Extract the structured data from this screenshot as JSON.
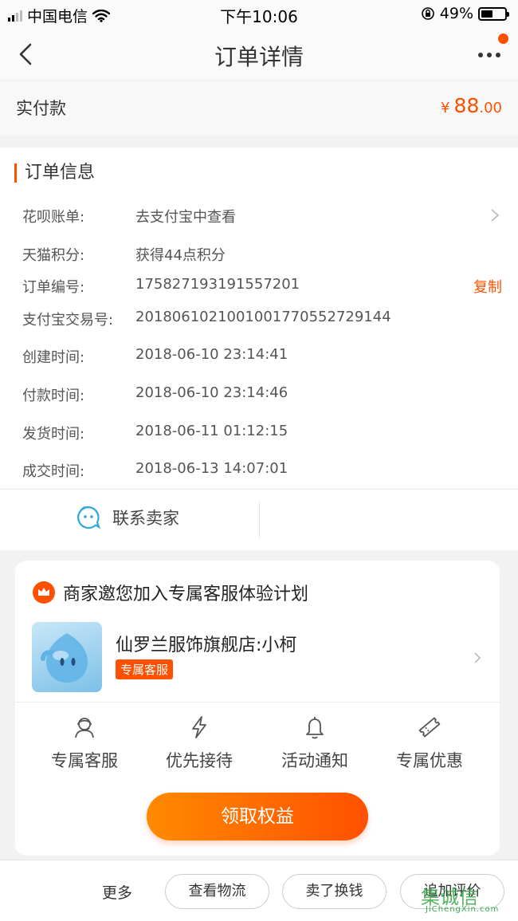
{
  "status_bar": {
    "carrier": "中国电信",
    "time": "下午10:06",
    "battery": "49%",
    "battery_level": 0.49
  },
  "nav": {
    "title": "订单详情"
  },
  "payment": {
    "label": "实付款",
    "currency": "¥",
    "amount_int": "88",
    "amount_dec": ".00"
  },
  "order_info": {
    "title": "订单信息",
    "rows": [
      {
        "key": "花呗账单:",
        "value": "去支付宝中查看"
      },
      {
        "key": "天猫积分:",
        "value": "获得44点积分"
      },
      {
        "key": "订单编号:",
        "value": "175827193191557201",
        "action": "复制"
      },
      {
        "key": "支付宝交易号:",
        "value": "2018061021001001770552729144"
      },
      {
        "key": "创建时间:",
        "value": "2018-06-10 23:14:41"
      },
      {
        "key": "付款时间:",
        "value": "2018-06-10 23:14:46"
      },
      {
        "key": "发货时间:",
        "value": "2018-06-11 01:12:15"
      },
      {
        "key": "成交时间:",
        "value": "2018-06-13 14:07:01"
      }
    ],
    "contact_label": "联系卖家"
  },
  "service_card": {
    "title": "商家邀您加入专属客服体验计划",
    "store_name": "仙罗兰服饰旗舰店:小柯",
    "badge": "专属客服",
    "benefits": [
      {
        "label": "专属客服",
        "icon": "support-agent-icon"
      },
      {
        "label": "优先接待",
        "icon": "lightning-icon"
      },
      {
        "label": "活动通知",
        "icon": "bell-icon"
      },
      {
        "label": "专属优惠",
        "icon": "ticket-icon"
      }
    ],
    "cta": "领取权益"
  },
  "bottom_bar": {
    "more": "更多",
    "buttons": [
      "查看物流",
      "卖了换钱",
      "追加评价"
    ]
  },
  "colors": {
    "accent": "#ff5000",
    "background": "#f2f2f2"
  }
}
